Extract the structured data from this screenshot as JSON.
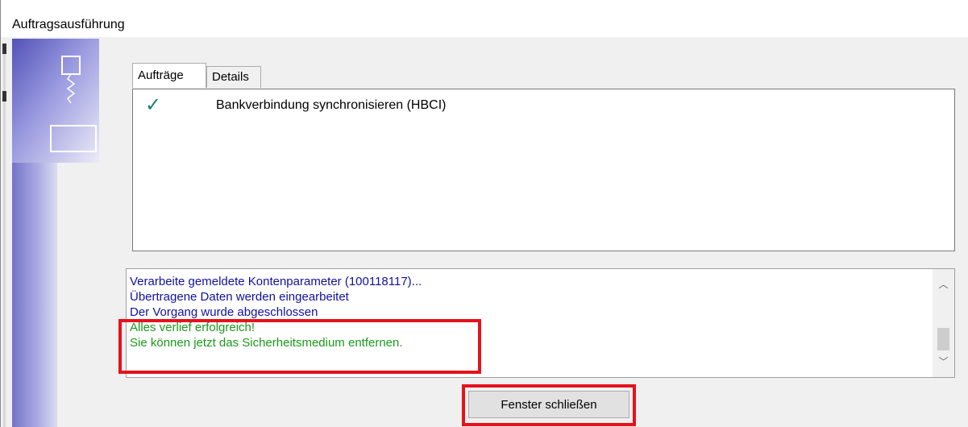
{
  "window": {
    "title": "Auftragsausführung"
  },
  "tabs": [
    {
      "label": "Aufträge",
      "active": true
    },
    {
      "label": "Details",
      "active": false
    }
  ],
  "jobs": [
    {
      "status_icon": "check-icon",
      "label": "Bankverbindung synchronisieren (HBCI)"
    }
  ],
  "log": {
    "lines": [
      {
        "text": "Verarbeite gemeldete Kontenparameter (100118117)...",
        "type": "info"
      },
      {
        "text": "Übertragene Daten werden eingearbeitet",
        "type": "info"
      },
      {
        "text": "Der Vorgang wurde abgeschlossen",
        "type": "info"
      },
      {
        "text": "Alles verlief erfolgreich!",
        "type": "success"
      },
      {
        "text": "Sie können jetzt das Sicherheitsmedium entfernen.",
        "type": "success"
      }
    ],
    "scroll_up_icon": "chevron-up-icon",
    "scroll_down_icon": "chevron-down-icon"
  },
  "footer": {
    "close_label": "Fenster schließen"
  },
  "colors": {
    "log_info": "#1010a0",
    "log_success": "#1a9a1a",
    "highlight": "#e5121b",
    "check": "#1f7a74"
  }
}
